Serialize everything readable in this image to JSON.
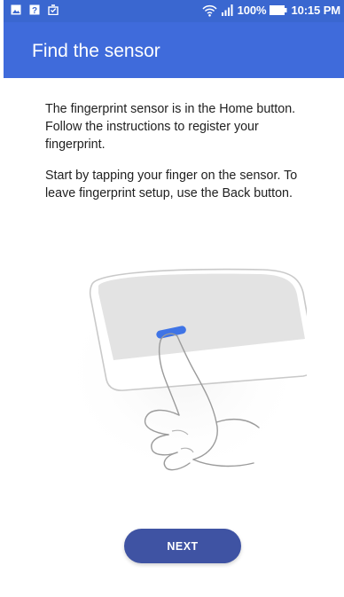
{
  "status_bar": {
    "battery": "100%",
    "time": "10:15 PM",
    "icons": [
      "image-icon",
      "unknown-app-icon",
      "clipboard-check-icon",
      "wifi-icon",
      "signal-icon",
      "battery-charging-icon"
    ]
  },
  "app_bar": {
    "title": "Find the sensor"
  },
  "content": {
    "paragraph_1": "The fingerprint sensor is in the Home button. Follow the instructions to register your fingerprint.",
    "paragraph_2": "Start by tapping your finger on the sensor. To leave fingerprint setup, use the Back button."
  },
  "actions": {
    "next_label": "NEXT"
  },
  "colors": {
    "status_bar": "#3a67d0",
    "app_bar": "#3f6bdb",
    "button": "#3f53a3",
    "sensor": "#3f74e6"
  }
}
